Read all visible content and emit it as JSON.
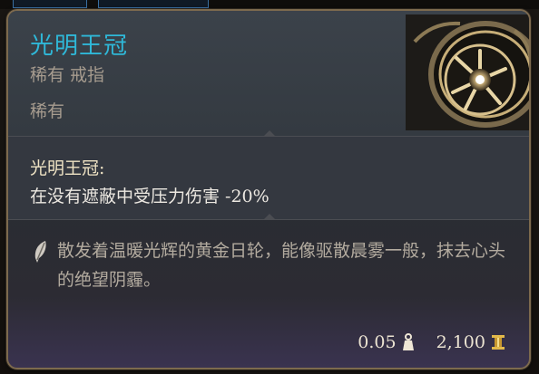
{
  "item": {
    "name": "光明王冠",
    "type": "稀有 戒指",
    "rarity": "稀有",
    "effect_name": "光明王冠:",
    "effect_text": "在没有遮蔽中受压力伤害 -20%",
    "lore": "散发着温暖光辉的黄金日轮，能像驱散晨雾一般，抹去心头的绝望阴霾。",
    "weight": "0.05",
    "value": "2,100",
    "icons": {
      "ring": "ring-icon",
      "lore": "feather-icon",
      "weight": "weight-icon",
      "value": "gold-coin-icon"
    }
  },
  "colors": {
    "title": "#2fb8d8",
    "border": "#7d6a4e"
  }
}
